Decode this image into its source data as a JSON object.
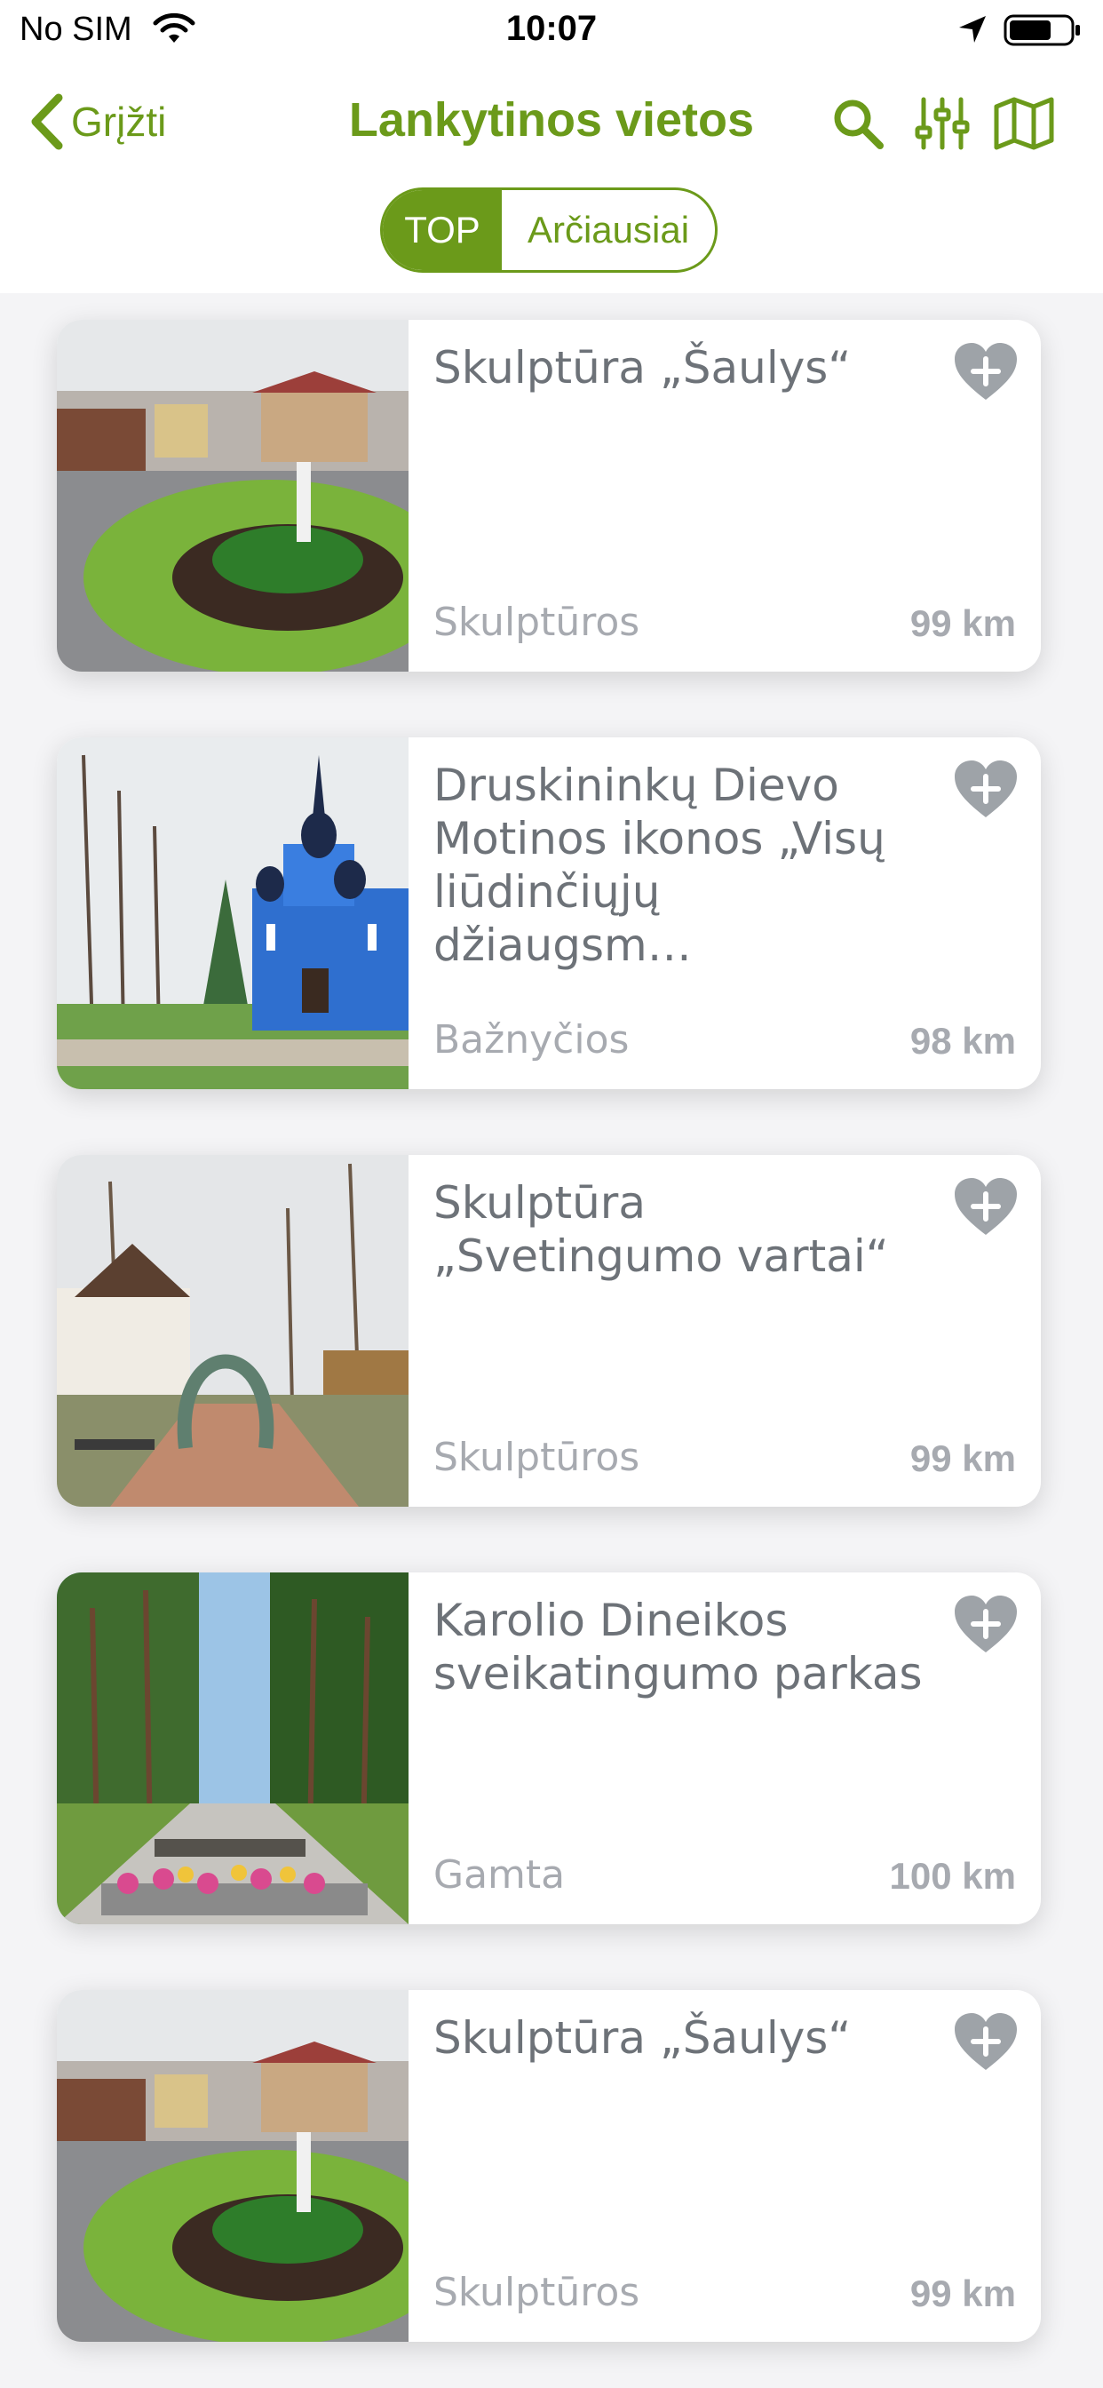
{
  "status": {
    "carrier": "No SIM",
    "time": "10:07"
  },
  "nav": {
    "back_label": "Grįžti",
    "title": "Lankytinos vietos"
  },
  "segments": {
    "active": "TOP",
    "inactive": "Arčiausiai"
  },
  "colors": {
    "accent": "#6b9a1a",
    "text": "#6d7278",
    "muted": "#a7aab0"
  },
  "places": [
    {
      "title": "Skulptūra „Šaulys“",
      "category": "Skulptūros",
      "distance": "99 km",
      "image": "sculpture-roundabout"
    },
    {
      "title": "Druskininkų Dievo Motinos ikonos „Visų liūdinčiųjų džiaugsm…",
      "category": "Bažnyčios",
      "distance": "98 km",
      "image": "blue-church"
    },
    {
      "title": "Skulptūra „Svetingumo vartai“",
      "category": "Skulptūros",
      "distance": "99 km",
      "image": "horseshoe-gate"
    },
    {
      "title": "Karolio Dineikos sveikatingumo parkas",
      "category": "Gamta",
      "distance": "100 km",
      "image": "pine-park"
    },
    {
      "title": "Skulptūra „Šaulys“",
      "category": "Skulptūros",
      "distance": "99 km",
      "image": "sculpture-roundabout"
    }
  ]
}
